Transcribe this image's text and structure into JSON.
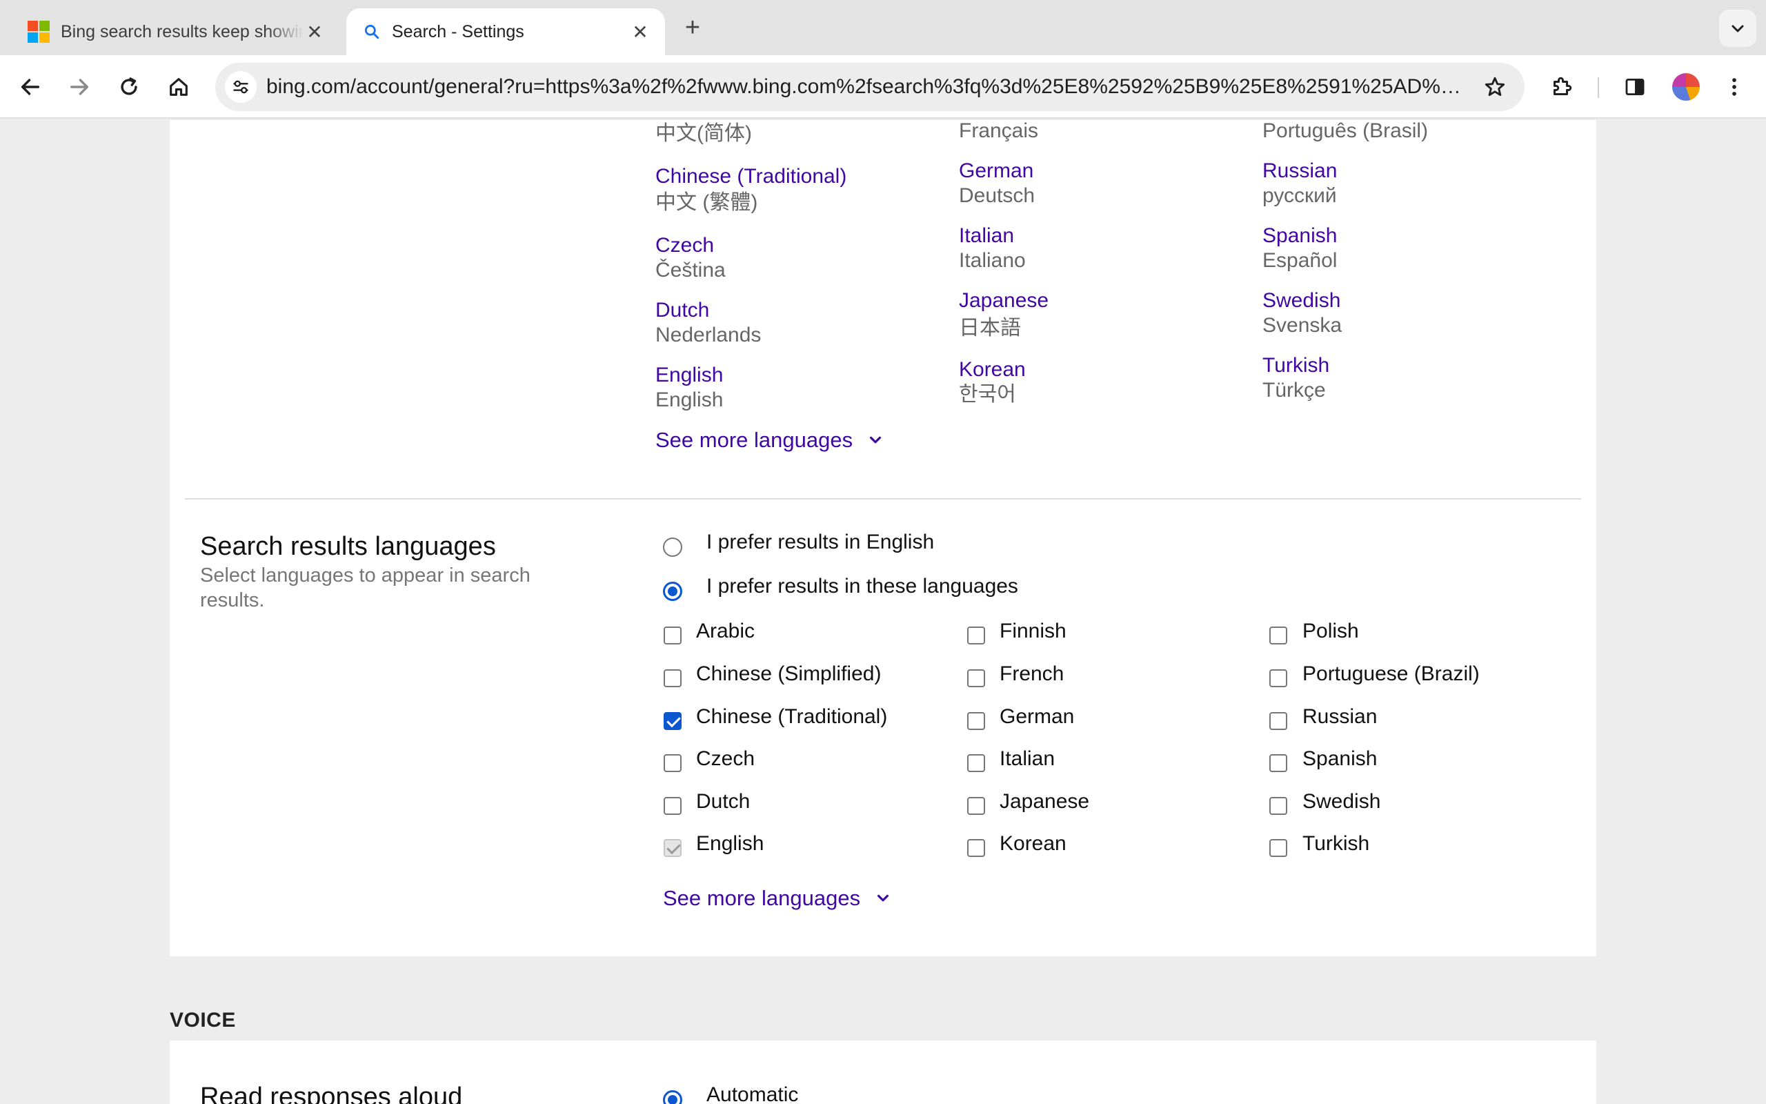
{
  "browser": {
    "tabs": [
      {
        "title": "Bing search results keep showing Chinese",
        "active": false
      },
      {
        "title": "Search - Settings",
        "active": true
      }
    ],
    "new_tab_symbol": "+",
    "close_symbol": "✕",
    "url": "bing.com/account/general?ru=https%3a%2f%2fwww.bing.com%2fsearch%3fq%3d%25E8%2592%25B9%25E8%2591%25AD%2..."
  },
  "display_languages": {
    "columns": [
      [
        {
          "name": "",
          "native": "中文(简体)"
        },
        {
          "name": "Chinese (Traditional)",
          "native": "中文 (繁體)"
        },
        {
          "name": "Czech",
          "native": "Čeština"
        },
        {
          "name": "Dutch",
          "native": "Nederlands"
        },
        {
          "name": "English",
          "native": "English"
        }
      ],
      [
        {
          "name": "",
          "native": "Français"
        },
        {
          "name": "German",
          "native": "Deutsch"
        },
        {
          "name": "Italian",
          "native": "Italiano"
        },
        {
          "name": "Japanese",
          "native": "日本語"
        },
        {
          "name": "Korean",
          "native": "한국어"
        }
      ],
      [
        {
          "name": "",
          "native": "Português (Brasil)"
        },
        {
          "name": "Russian",
          "native": "русский"
        },
        {
          "name": "Spanish",
          "native": "Español"
        },
        {
          "name": "Swedish",
          "native": "Svenska"
        },
        {
          "name": "Turkish",
          "native": "Türkçe"
        }
      ]
    ],
    "see_more": "See more languages"
  },
  "search_results_languages": {
    "title": "Search results languages",
    "description": "Select languages to appear in search results.",
    "options": [
      {
        "label": "I prefer results in English",
        "selected": false
      },
      {
        "label": "I prefer results in these languages",
        "selected": true
      }
    ],
    "columns": [
      [
        {
          "label": "Arabic",
          "state": "unchecked"
        },
        {
          "label": "Chinese (Simplified)",
          "state": "unchecked"
        },
        {
          "label": "Chinese (Traditional)",
          "state": "checked"
        },
        {
          "label": "Czech",
          "state": "unchecked"
        },
        {
          "label": "Dutch",
          "state": "unchecked"
        },
        {
          "label": "English",
          "state": "disabled"
        }
      ],
      [
        {
          "label": "Finnish",
          "state": "unchecked"
        },
        {
          "label": "French",
          "state": "unchecked"
        },
        {
          "label": "German",
          "state": "unchecked"
        },
        {
          "label": "Italian",
          "state": "unchecked"
        },
        {
          "label": "Japanese",
          "state": "unchecked"
        },
        {
          "label": "Korean",
          "state": "unchecked"
        }
      ],
      [
        {
          "label": "Polish",
          "state": "unchecked"
        },
        {
          "label": "Portuguese (Brazil)",
          "state": "unchecked"
        },
        {
          "label": "Russian",
          "state": "unchecked"
        },
        {
          "label": "Spanish",
          "state": "unchecked"
        },
        {
          "label": "Swedish",
          "state": "unchecked"
        },
        {
          "label": "Turkish",
          "state": "unchecked"
        }
      ]
    ],
    "see_more": "See more languages"
  },
  "voice": {
    "header": "VOICE",
    "title": "Read responses aloud",
    "option": "Automatic"
  },
  "colors": {
    "link": "#4007a2",
    "accent": "#0b57d0"
  },
  "icons": {
    "back": "arrow-left-icon",
    "forward": "arrow-right-icon",
    "reload": "reload-icon",
    "home": "home-icon",
    "site_info": "tune-icon",
    "bookmark": "star-icon",
    "extensions": "puzzle-icon",
    "side_panel": "side-panel-icon",
    "menu": "kebab-menu-icon"
  }
}
